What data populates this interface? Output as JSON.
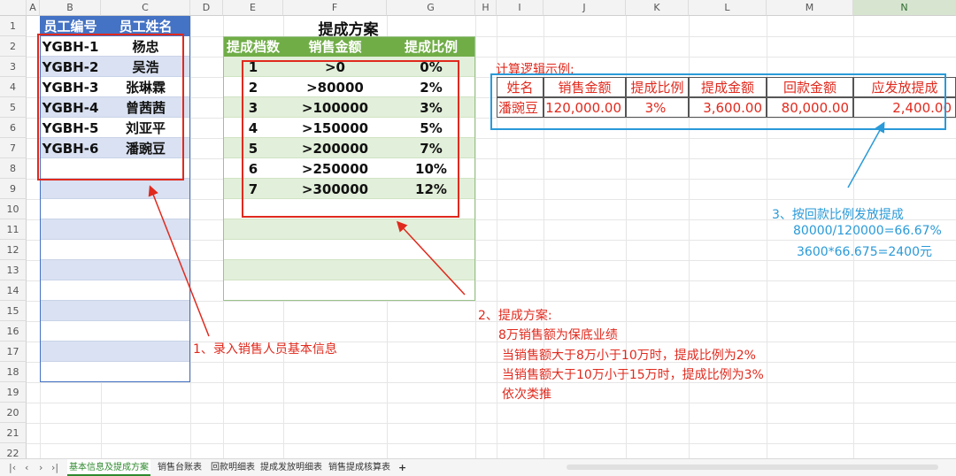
{
  "columns": [
    "A",
    "B",
    "C",
    "D",
    "E",
    "F",
    "G",
    "H",
    "I",
    "J",
    "K",
    "L",
    "M",
    "N"
  ],
  "rows": [
    "1",
    "2",
    "3",
    "4",
    "5",
    "6",
    "7",
    "8",
    "9",
    "10",
    "11",
    "12",
    "13",
    "14",
    "15",
    "16",
    "17",
    "18",
    "19",
    "20",
    "21",
    "22"
  ],
  "employee_table": {
    "headers": [
      "员工编号",
      "员工姓名"
    ],
    "rows": [
      [
        "YGBH-1",
        "杨忠"
      ],
      [
        "YGBH-2",
        "吴浩"
      ],
      [
        "YGBH-3",
        "张琳霖"
      ],
      [
        "YGBH-4",
        "曾茜茜"
      ],
      [
        "YGBH-5",
        "刘亚平"
      ],
      [
        "YGBH-6",
        "潘豌豆"
      ]
    ]
  },
  "commission_scheme": {
    "title": "提成方案",
    "headers": [
      "提成档数",
      "销售金额",
      "提成比例"
    ],
    "rows": [
      [
        "1",
        ">0",
        "0%"
      ],
      [
        "2",
        ">80000",
        "2%"
      ],
      [
        "3",
        ">100000",
        "3%"
      ],
      [
        "4",
        ">150000",
        "5%"
      ],
      [
        "5",
        ">200000",
        "7%"
      ],
      [
        "6",
        ">250000",
        "10%"
      ],
      [
        "7",
        ">300000",
        "12%"
      ]
    ]
  },
  "example": {
    "title": "计算逻辑示例:",
    "headers": [
      "姓名",
      "销售金额",
      "提成比例",
      "提成金额",
      "回款金额",
      "应发放提成"
    ],
    "row": [
      "潘豌豆",
      "120,000.00",
      "3%",
      "3,600.00",
      "80,000.00",
      "2,400.00"
    ]
  },
  "notes": {
    "note1": "1、录入销售人员基本信息",
    "note2_lines": [
      "2、提成方案:",
      "8万销售额为保底业绩",
      "当销售额大于8万小于10万时，提成比例为2%",
      "当销售额大于10万小于15万时，提成比例为3%",
      "依次类推"
    ],
    "note3_lines": [
      "3、按回款比例发放提成",
      "80000/120000=66.67%",
      "3600*66.675=2400元"
    ]
  },
  "sheet_tabs": [
    "基本信息及提成方案",
    "销售台账表",
    "回款明细表",
    "提成发放明细表",
    "销售提成核算表"
  ],
  "active_tab": 0,
  "colors": {
    "header_blue": "#4472c4",
    "band_blue": "#d9e1f2",
    "header_green": "#70ad47",
    "band_green": "#e2efda",
    "red": "#e02a1e",
    "blue": "#2a9ad8"
  }
}
